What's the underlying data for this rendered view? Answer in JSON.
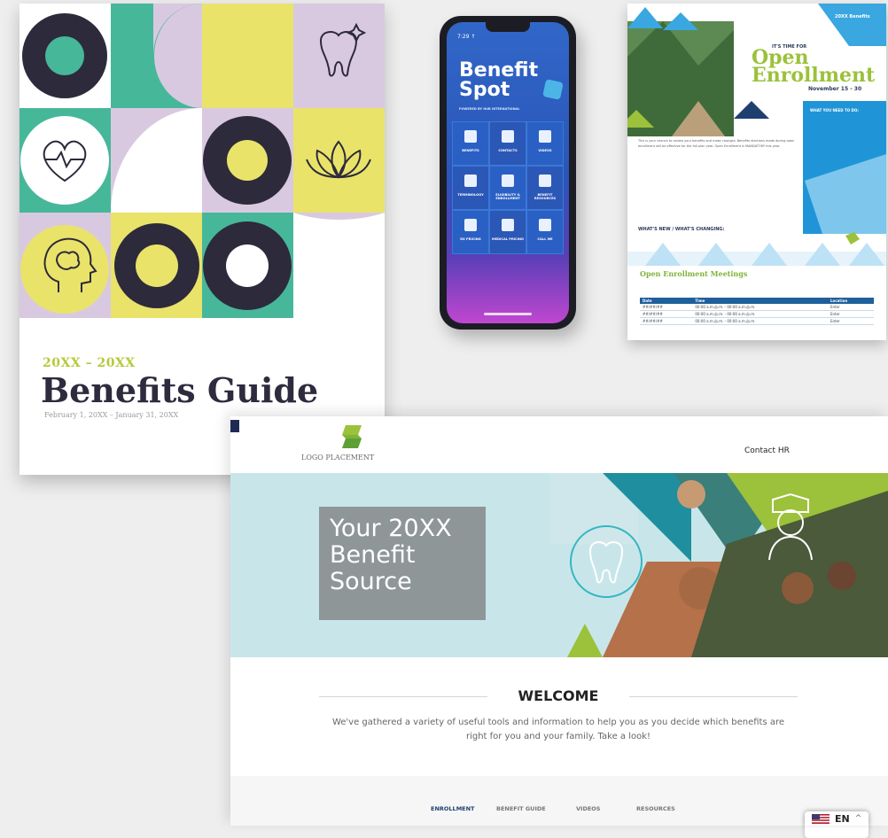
{
  "guide": {
    "years": "20XX – 20XX",
    "title": "Benefits Guide",
    "dates": "February 1, 20XX – January 31, 20XX",
    "icons": [
      "tooth-icon",
      "heart-pulse-icon",
      "lotus-icon",
      "brain-head-icon"
    ]
  },
  "phone": {
    "time": "7:29 ↑",
    "brand_line1": "Benefit",
    "brand_line2": "Spot",
    "powered": "POWERED BY HUB INTERNATIONAL",
    "tiles": [
      {
        "label": "BENEFITS",
        "icon": "briefcase-icon"
      },
      {
        "label": "CONTACTS",
        "icon": "contacts-icon"
      },
      {
        "label": "VIDEOS",
        "icon": "video-icon"
      },
      {
        "label": "TERMINOLOGY",
        "icon": "glossary-icon"
      },
      {
        "label": "ELIGIBILITY & ENROLLMENT",
        "icon": "enrollment-icon"
      },
      {
        "label": "BENEFIT RESOURCES",
        "icon": "resources-icon"
      },
      {
        "label": "RX PRICING",
        "icon": "rx-icon"
      },
      {
        "label": "MEDICAL PRICING",
        "icon": "medical-icon"
      },
      {
        "label": "CALL ME",
        "icon": "megaphone-icon"
      }
    ]
  },
  "flyer": {
    "corner": "20XX Benefits",
    "kicker": "IT'S TIME FOR",
    "title_line1": "Open",
    "title_line2": "Enrollment",
    "date": "November 15 - 30",
    "need_title": "WHAT YOU NEED TO DO:",
    "body": "This is your chance to review your benefits and make changes. Benefits elections made during open enrollment will be effective for the full plan year. Open Enrollment is MANDATORY this year.",
    "whats_new": "WHAT'S NEW / WHAT'S CHANGING:",
    "meetings_title": "Open Enrollment Meetings",
    "table_headers": [
      "Date",
      "Time",
      "Location"
    ],
    "table_rows": [
      [
        "##/##/##",
        "00:00 a.m./p.m. - 00:00 a.m./p.m.",
        "Enter"
      ],
      [
        "##/##/##",
        "00:00 a.m./p.m. - 00:00 a.m./p.m.",
        "Enter"
      ],
      [
        "##/##/##",
        "00:00 a.m./p.m. - 00:00 a.m./p.m.",
        "Enter"
      ]
    ]
  },
  "site": {
    "logo_text": "LOGO PLACEMENT",
    "contact": "Contact HR",
    "hero_title": "Your 20XX\nBenefit\nSource",
    "welcome_title": "WELCOME",
    "welcome_text": "We've gathered a variety of useful tools and information to help you as you decide which benefits are right for you and your family. Take a look!",
    "footer_nav": [
      "ENROLLMENT",
      "BENEFIT GUIDE",
      "VIDEOS",
      "RESOURCES"
    ],
    "active_nav": "ENROLLMENT",
    "colors": {
      "lime": "#a9c93a",
      "teal": "#c8e6ea",
      "navy": "#1f2a54",
      "gray_box": "#8e9698"
    }
  },
  "language": {
    "code": "EN",
    "flag": "us-flag-icon",
    "caret": "^"
  }
}
